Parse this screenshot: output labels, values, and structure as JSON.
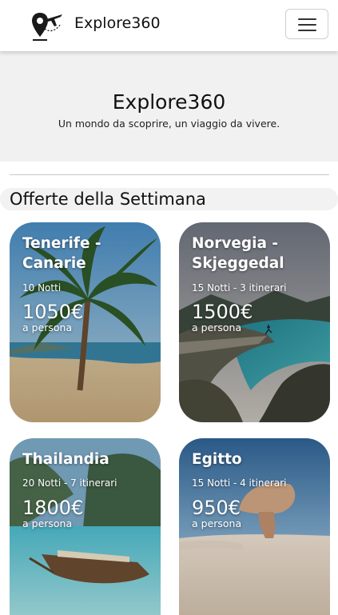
{
  "navbar": {
    "brand": "Explore360",
    "logo_icon": "map-pin-airplane-icon",
    "menu_icon": "hamburger-menu-icon"
  },
  "hero": {
    "title": "Explore360",
    "subtitle": "Un mondo da scoprire, un viaggio da vivere."
  },
  "section": {
    "title": "Offerte della Settimana"
  },
  "offers": [
    {
      "name": "Tenerife - Canarie",
      "info": "10 Notti",
      "price": "1050€",
      "per": "a persona"
    },
    {
      "name": "Norvegia - Skjeggedal",
      "info": "15 Notti - 3 itinerari",
      "price": "1500€",
      "per": "a persona"
    },
    {
      "name": "Thailandia",
      "info": "20 Notti - 7 itinerari",
      "price": "1800€",
      "per": "a persona"
    },
    {
      "name": "Egitto",
      "info": "15 Notti - 4 itinerari",
      "price": "950€",
      "per": "a persona"
    }
  ]
}
